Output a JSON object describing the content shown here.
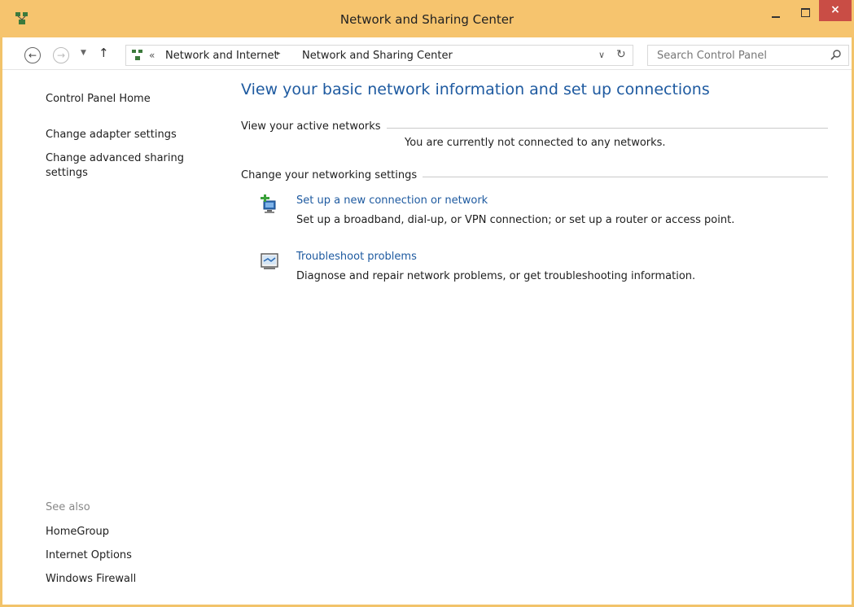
{
  "window": {
    "title": "Network and Sharing Center",
    "close_label": "×"
  },
  "navigation": {
    "back_icon": "back-arrow-icon",
    "forward_icon": "forward-arrow-icon",
    "recent_icon": "chevron-down-icon",
    "up_icon": "up-arrow-icon"
  },
  "address": {
    "separator": "«",
    "breadcrumb": [
      "Network and Internet",
      "Network and Sharing Center"
    ],
    "arrow": "▸",
    "dropdown": "∨",
    "refresh": "↻"
  },
  "search": {
    "placeholder": "Search Control Panel"
  },
  "sidebar": {
    "home": "Control Panel Home",
    "items": [
      "Change adapter settings",
      "Change advanced sharing settings"
    ],
    "see_also_label": "See also",
    "see_also": [
      "HomeGroup",
      "Internet Options",
      "Windows Firewall"
    ]
  },
  "main": {
    "title": "View your basic network information and set up connections",
    "active_networks_label": "View your active networks",
    "active_networks_status": "You are currently not connected to any networks.",
    "change_settings_label": "Change your networking settings",
    "tasks": [
      {
        "link": "Set up a new connection or network",
        "description": "Set up a broadband, dial-up, or VPN connection; or set up a router or access point.",
        "icon": "new-connection-icon"
      },
      {
        "link": "Troubleshoot problems",
        "description": "Diagnose and repair network problems, or get troubleshooting information.",
        "icon": "troubleshoot-icon"
      }
    ]
  },
  "colors": {
    "titlebar": "#f6c46e",
    "close_button": "#c94d45",
    "link": "#1e5aa0"
  }
}
